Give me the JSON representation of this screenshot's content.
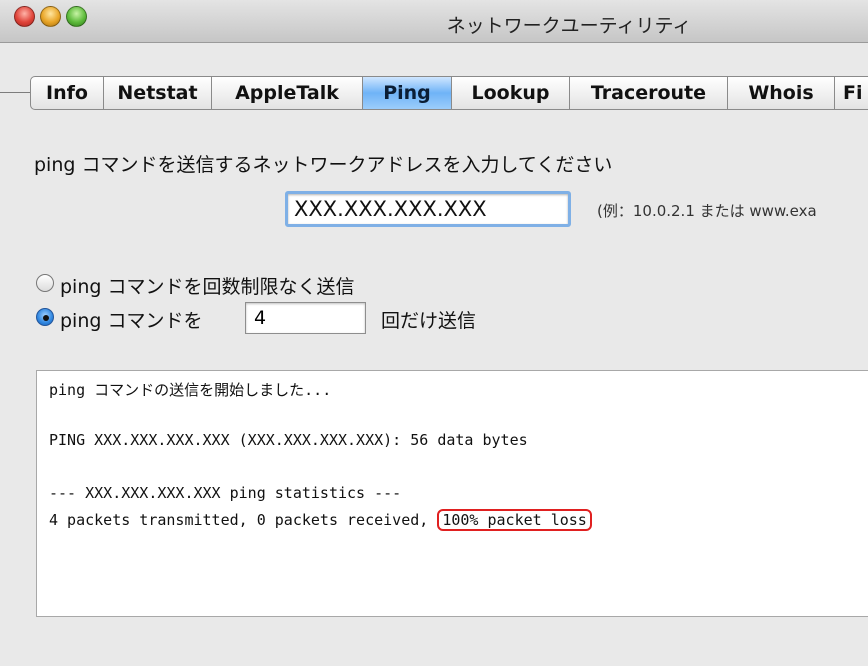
{
  "window": {
    "title": "ネットワークユーティリティ"
  },
  "tabs": [
    "Info",
    "Netstat",
    "AppleTalk",
    "Ping",
    "Lookup",
    "Traceroute",
    "Whois",
    "Fi"
  ],
  "active_tab": "Ping",
  "form": {
    "prompt": "ping コマンドを送信するネットワークアドレスを入力してください",
    "address_value": "XXX.XXX.XXX.XXX",
    "example": "(例：10.0.2.1 または www.exa",
    "radio_unlimited": "ping コマンドを回数制限なく送信",
    "radio_count_prefix": "ping コマンドを",
    "count_value": "4",
    "radio_count_suffix": "回だけ送信"
  },
  "output": {
    "line1": "ping コマンドの送信を開始しました...",
    "line2": "PING XXX.XXX.XXX.XXX (XXX.XXX.XXX.XXX): 56 data bytes",
    "line3": "--- XXX.XXX.XXX.XXX ping statistics ---",
    "line4_prefix": "4 packets transmitted, 0 packets received,",
    "line4_highlight": "100% packet loss"
  },
  "colors": {
    "highlight_border": "#e02020",
    "active_tab": "#6fb3f7"
  }
}
